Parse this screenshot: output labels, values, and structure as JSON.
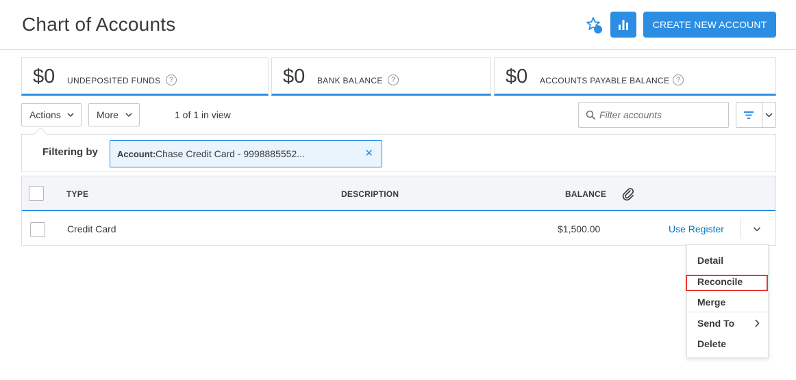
{
  "header": {
    "title": "Chart of Accounts",
    "create_label": "CREATE NEW ACCOUNT"
  },
  "summary": [
    {
      "amount": "$0",
      "label": "UNDEPOSITED FUNDS",
      "help": "?"
    },
    {
      "amount": "$0",
      "label": "BANK BALANCE",
      "help": "?"
    },
    {
      "amount": "$0",
      "label": "ACCOUNTS PAYABLE BALANCE",
      "help": "?"
    }
  ],
  "toolbar": {
    "actions_label": "Actions",
    "more_label": "More",
    "in_view": "1 of 1 in view",
    "filter_placeholder": "Filter accounts"
  },
  "filter": {
    "label": "Filtering by",
    "pill_key": "Account:",
    "pill_value": "Chase Credit Card - 9998885552...",
    "close": "✕"
  },
  "table": {
    "columns": {
      "type": "TYPE",
      "description": "DESCRIPTION",
      "balance": "BALANCE"
    },
    "rows": [
      {
        "type": "Credit Card",
        "description": "",
        "balance": "$1,500.00",
        "action": "Use Register"
      }
    ]
  },
  "row_menu": {
    "items": [
      "Detail",
      "Reconcile",
      "Merge",
      "Send To",
      "Delete"
    ]
  },
  "colors": {
    "accent": "#2b8ee3",
    "link": "#0077c5",
    "highlight": "#e53935",
    "pill_bg": "#eaf4fc"
  },
  "icons": {
    "favorite": "star-icon",
    "reports": "bar-chart-icon",
    "search": "search-icon",
    "filter": "filter-icon",
    "attachment": "paperclip-icon"
  }
}
